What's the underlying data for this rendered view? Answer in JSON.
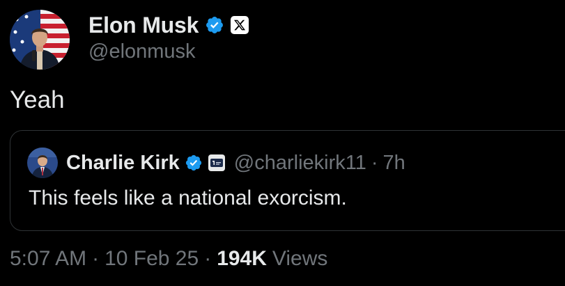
{
  "author": {
    "display_name": "Elon Musk",
    "handle": "@elonmusk",
    "verified": true,
    "affiliate_badge": "X",
    "avatar_icon": "profile-photo-with-flag"
  },
  "tweet": {
    "text": "Yeah"
  },
  "quoted": {
    "display_name": "Charlie Kirk",
    "handle": "@charliekirk11",
    "separator": "·",
    "time_ago": "7h",
    "text": "This feels like a national exorcism.",
    "verified": true,
    "affiliate_badge_icon": "turning-point-badge-icon"
  },
  "meta": {
    "time": "5:07 AM",
    "separator": "·",
    "date": "10 Feb 25",
    "views_count": "194K",
    "views_label": "Views"
  },
  "colors": {
    "background": "#000000",
    "text_primary": "#e7e9ea",
    "text_secondary": "#71767b",
    "verified_blue": "#1d9bf0",
    "card_border": "#2f3336"
  }
}
